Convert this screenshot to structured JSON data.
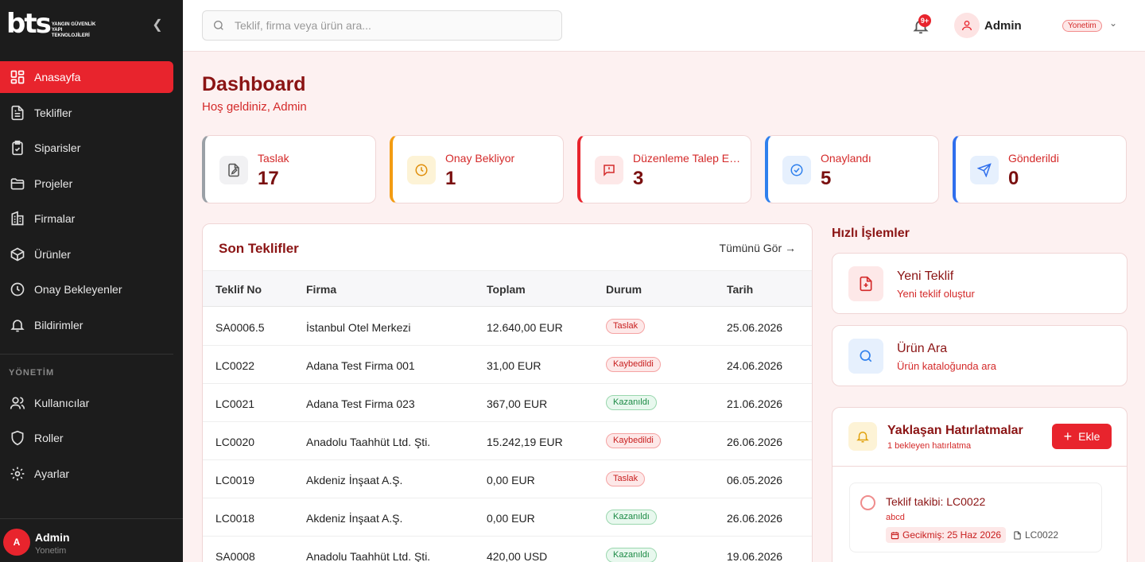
{
  "brand": {
    "logo_text": "bts",
    "logo_sub": "YANGIN GÜVENLİK YAPI TEKNOLOJİLERİ"
  },
  "sidebar": {
    "items": [
      {
        "label": "Anasayfa",
        "icon": "grid-icon",
        "active": true
      },
      {
        "label": "Teklifler",
        "icon": "document-icon"
      },
      {
        "label": "Siparisler",
        "icon": "clipboard-check-icon"
      },
      {
        "label": "Projeler",
        "icon": "folder-icon"
      },
      {
        "label": "Firmalar",
        "icon": "building-icon"
      },
      {
        "label": "Ürünler",
        "icon": "box-icon"
      },
      {
        "label": "Onay Bekleyenler",
        "icon": "clock-icon"
      },
      {
        "label": "Bildirimler",
        "icon": "bell-icon"
      }
    ],
    "section_label": "YÖNETİM",
    "admin_items": [
      {
        "label": "Kullanıcılar",
        "icon": "users-icon"
      },
      {
        "label": "Roller",
        "icon": "shield-icon"
      },
      {
        "label": "Ayarlar",
        "icon": "gear-icon"
      }
    ],
    "footer": {
      "avatar_letter": "A",
      "name": "Admin",
      "role": "Yonetim"
    }
  },
  "topbar": {
    "search_placeholder": "Teklif, firma veya ürün ara...",
    "notification_badge": "9+",
    "user_name": "Admin",
    "user_role": "Yonetim"
  },
  "page": {
    "title": "Dashboard",
    "subtitle": "Hoş geldiniz, Admin"
  },
  "stats": [
    {
      "label": "Taslak",
      "value": "17",
      "color": "#9aa0a6",
      "icon": "file-edit-icon"
    },
    {
      "label": "Onay Bekliyor",
      "value": "1",
      "color": "#f39c12",
      "icon": "clock-icon"
    },
    {
      "label": "Düzenleme Talep Edildi",
      "value": "3",
      "color": "#e8242d",
      "icon": "message-alert-icon"
    },
    {
      "label": "Onaylandı",
      "value": "5",
      "color": "#2f80ed",
      "icon": "check-circle-icon"
    },
    {
      "label": "Gönderildi",
      "value": "0",
      "color": "#2f6fed",
      "icon": "send-icon"
    }
  ],
  "recent_offers": {
    "title": "Son Teklifler",
    "see_all": "Tümünü Gör →",
    "columns": [
      "Teklif No",
      "Firma",
      "Toplam",
      "Durum",
      "Tarih"
    ],
    "rows": [
      {
        "no": "SA0006.5",
        "firma": "İstanbul Otel Merkezi",
        "toplam": "12.640,00 EUR",
        "durum": "Taslak",
        "tone": "red",
        "tarih": "25.06.2026"
      },
      {
        "no": "LC0022",
        "firma": "Adana Test Firma 001",
        "toplam": "31,00 EUR",
        "durum": "Kaybedildi",
        "tone": "red",
        "tarih": "24.06.2026"
      },
      {
        "no": "LC0021",
        "firma": "Adana Test Firma 023",
        "toplam": "367,00 EUR",
        "durum": "Kazanıldı",
        "tone": "green",
        "tarih": "21.06.2026"
      },
      {
        "no": "LC0020",
        "firma": "Anadolu Taahhüt Ltd. Şti.",
        "toplam": "15.242,19 EUR",
        "durum": "Kaybedildi",
        "tone": "red",
        "tarih": "26.06.2026"
      },
      {
        "no": "LC0019",
        "firma": "Akdeniz İnşaat A.Ş.",
        "toplam": "0,00 EUR",
        "durum": "Taslak",
        "tone": "red",
        "tarih": "06.05.2026"
      },
      {
        "no": "LC0018",
        "firma": "Akdeniz İnşaat A.Ş.",
        "toplam": "0,00 EUR",
        "durum": "Kazanıldı",
        "tone": "green",
        "tarih": "26.06.2026"
      },
      {
        "no": "SA0008",
        "firma": "Anadolu Taahhüt Ltd. Şti.",
        "toplam": "420,00 USD",
        "durum": "Kazanıldı",
        "tone": "green",
        "tarih": "19.06.2026"
      }
    ]
  },
  "quick_actions": {
    "title": "Hızlı İşlemler",
    "items": [
      {
        "label": "Yeni Teklif",
        "desc": "Yeni teklif oluştur",
        "icon": "file-plus-icon"
      },
      {
        "label": "Ürün Ara",
        "desc": "Ürün kataloğunda ara",
        "icon": "search-icon"
      }
    ]
  },
  "reminders": {
    "title": "Yaklaşan Hatırlatmalar",
    "subtitle": "1 bekleyen hatırlatma",
    "add_label": "Ekle",
    "items": [
      {
        "title": "Teklif takibi: LC0022",
        "note": "abcd",
        "overdue": "Gecikmiş: 25 Haz 2026",
        "ref": "LC0022"
      }
    ]
  }
}
